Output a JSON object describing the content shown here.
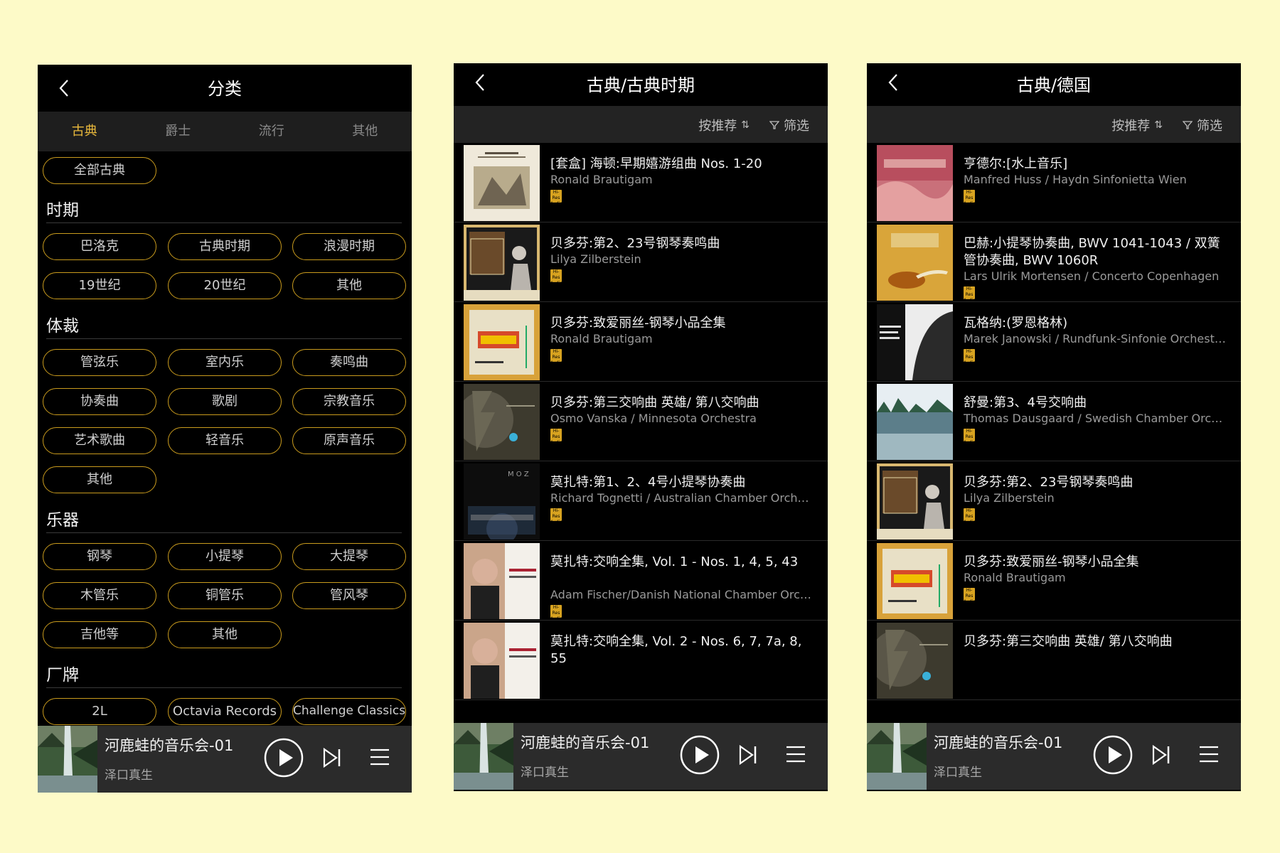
{
  "screen1": {
    "title": "分类",
    "tabs": [
      "古典",
      "爵士",
      "流行",
      "其他"
    ],
    "all_label": "全部古典",
    "sections": [
      {
        "heading": "时期",
        "items": [
          "巴洛克",
          "古典时期",
          "浪漫时期",
          "19世纪",
          "20世纪",
          "其他"
        ]
      },
      {
        "heading": "体裁",
        "items": [
          "管弦乐",
          "室内乐",
          "奏鸣曲",
          "协奏曲",
          "歌剧",
          "宗教音乐",
          "艺术歌曲",
          "轻音乐",
          "原声音乐",
          "其他"
        ]
      },
      {
        "heading": "乐器",
        "items": [
          "钢琴",
          "小提琴",
          "大提琴",
          "木管乐",
          "铜管乐",
          "管风琴",
          "吉他等",
          "其他"
        ]
      },
      {
        "heading": "厂牌",
        "items": [
          "2L",
          "Octavia Records",
          "Challenge Classics"
        ]
      }
    ]
  },
  "screen2": {
    "title": "古典/古典时期",
    "sort_label": "按推荐",
    "filter_label": "筛选",
    "albums": [
      {
        "title": "[套盒] 海顿:早期嬉游组曲 Nos. 1-20",
        "artist": "Ronald Brautigam",
        "cover": "haydn"
      },
      {
        "title": "贝多芬:第2、23号钢琴奏鸣曲",
        "artist": "Lilya Zilberstein",
        "cover": "piano"
      },
      {
        "title": "贝多芬:致爱丽丝-钢琴小品全集",
        "artist": "Ronald Brautigam",
        "cover": "beethovengang"
      },
      {
        "title": "贝多芬:第三交响曲 英雄/ 第八交响曲",
        "artist": "Osmo Vanska / Minnesota Orchestra",
        "cover": "three"
      },
      {
        "title": "莫扎特:第1、2、4号小提琴协奏曲",
        "artist": "Richard Tognetti / Australian Chamber Orchestra",
        "cover": "mozart"
      },
      {
        "title": "莫扎特:交响全集, Vol. 1 - Nos. 1, 4, 5, 43",
        "artist": "Adam Fischer/Danish National Chamber Orches...",
        "cover": "fischer"
      },
      {
        "title": "莫扎特:交响全集, Vol. 2 - Nos. 6, 7, 7a, 8, 55",
        "artist": "",
        "cover": "fischer"
      }
    ]
  },
  "screen3": {
    "title": "古典/德国",
    "sort_label": "按推荐",
    "filter_label": "筛选",
    "albums": [
      {
        "title": "亨德尔:[水上音乐]",
        "artist": "Manfred Huss / Haydn Sinfonietta Wien",
        "cover": "handel"
      },
      {
        "title": "巴赫:小提琴协奏曲, BWV 1041-1043 / 双簧管协奏曲, BWV 1060R",
        "artist": "Lars Ulrik Mortensen / Concerto Copenhagen",
        "cover": "bach"
      },
      {
        "title": "瓦格纳:(罗恩格林)",
        "artist": "Marek Janowski / Rundfunk-Sinfonie Orchester...",
        "cover": "wagner"
      },
      {
        "title": "舒曼:第3、4号交响曲",
        "artist": "Thomas Dausgaard / Swedish Chamber Orches...",
        "cover": "schumann"
      },
      {
        "title": "贝多芬:第2、23号钢琴奏鸣曲",
        "artist": "Lilya Zilberstein",
        "cover": "piano"
      },
      {
        "title": "贝多芬:致爱丽丝-钢琴小品全集",
        "artist": "Ronald Brautigam",
        "cover": "beethovengang"
      },
      {
        "title": "贝多芬:第三交响曲 英雄/ 第八交响曲",
        "artist": "",
        "cover": "three"
      }
    ]
  },
  "player": {
    "track": "河鹿蛙的音乐会-01",
    "artist": "泽口真生"
  },
  "hires_badge": [
    "Hi-Res",
    "Audio"
  ],
  "colors": {
    "accent": "#e9b93c",
    "pill_border": "#c99b1d",
    "background": "#fdfac8"
  }
}
